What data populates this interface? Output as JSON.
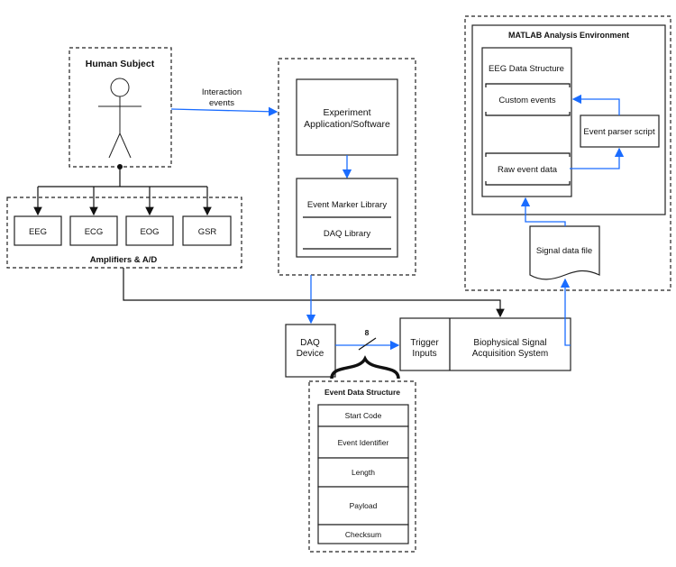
{
  "colors": {
    "flow_arrow": "#1a6cff",
    "connector": "#111111"
  },
  "human_subject": {
    "title": "Human Subject",
    "icon": "stick-figure-icon"
  },
  "amplifiers": {
    "title": "Amplifiers & A/D",
    "channels": [
      "EEG",
      "ECG",
      "EOG",
      "GSR"
    ]
  },
  "interaction": {
    "line1": "Interaction",
    "line2": "events"
  },
  "experiment": {
    "app_line1": "Experiment",
    "app_line2": "Application/Software",
    "event_marker_library": "Event Marker Library",
    "daq_library": "DAQ Library"
  },
  "daq_device": {
    "line1": "DAQ",
    "line2": "Device"
  },
  "bus_width": "8",
  "acquisition": {
    "trigger_line1": "Trigger",
    "trigger_line2": "Inputs",
    "system_line1": "Biophysical Signal",
    "system_line2": "Acquisition System"
  },
  "event_data_structure": {
    "title": "Event Data Structure",
    "fields": [
      "Start Code",
      "Event Identifier",
      "Length",
      "Payload",
      "Checksum"
    ]
  },
  "matlab": {
    "title": "MATLAB Analysis Environment",
    "eeg_structure": "EEG Data Structure",
    "custom_events": "Custom events",
    "raw_event_data": "Raw event data",
    "parser": "Event parser script",
    "signal_file": "Signal data file"
  }
}
